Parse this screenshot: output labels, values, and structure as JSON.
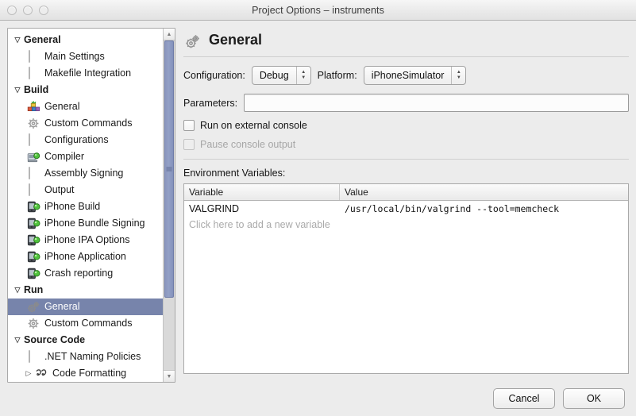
{
  "window": {
    "title": "Project Options – instruments",
    "traffic_lights": [
      "close",
      "minimize",
      "zoom"
    ]
  },
  "sidebar": {
    "items": [
      {
        "label": "General",
        "level": "group",
        "icon": "none",
        "twisty": "down",
        "selected": false
      },
      {
        "label": "Main Settings",
        "level": "child",
        "icon": "page",
        "twisty": "none",
        "selected": false
      },
      {
        "label": "Makefile Integration",
        "level": "child",
        "icon": "page",
        "twisty": "none",
        "selected": false
      },
      {
        "label": "Build",
        "level": "group",
        "icon": "none",
        "twisty": "down",
        "selected": false
      },
      {
        "label": "General",
        "level": "child",
        "icon": "blocks",
        "twisty": "none",
        "selected": false
      },
      {
        "label": "Custom Commands",
        "level": "child",
        "icon": "gear",
        "twisty": "none",
        "selected": false
      },
      {
        "label": "Configurations",
        "level": "child",
        "icon": "page",
        "twisty": "none",
        "selected": false
      },
      {
        "label": "Compiler",
        "level": "child",
        "icon": "compiler",
        "twisty": "none",
        "selected": false
      },
      {
        "label": "Assembly Signing",
        "level": "child",
        "icon": "page",
        "twisty": "none",
        "selected": false
      },
      {
        "label": "Output",
        "level": "child",
        "icon": "page",
        "twisty": "none",
        "selected": false
      },
      {
        "label": "iPhone Build",
        "level": "child",
        "icon": "phone",
        "twisty": "none",
        "selected": false
      },
      {
        "label": "iPhone Bundle Signing",
        "level": "child",
        "icon": "phone",
        "twisty": "none",
        "selected": false
      },
      {
        "label": "iPhone IPA Options",
        "level": "child",
        "icon": "phone",
        "twisty": "none",
        "selected": false
      },
      {
        "label": "iPhone Application",
        "level": "child",
        "icon": "phone",
        "twisty": "none",
        "selected": false
      },
      {
        "label": "Crash reporting",
        "level": "child",
        "icon": "phone",
        "twisty": "none",
        "selected": false
      },
      {
        "label": "Run",
        "level": "group",
        "icon": "none",
        "twisty": "down",
        "selected": false
      },
      {
        "label": "General",
        "level": "child",
        "icon": "gears",
        "twisty": "none",
        "selected": true
      },
      {
        "label": "Custom Commands",
        "level": "child",
        "icon": "gear",
        "twisty": "none",
        "selected": false
      },
      {
        "label": "Source Code",
        "level": "group",
        "icon": "none",
        "twisty": "down",
        "selected": false
      },
      {
        "label": ".NET Naming Policies",
        "level": "child",
        "icon": "page",
        "twisty": "none",
        "selected": false
      },
      {
        "label": "Code Formatting",
        "level": "child",
        "icon": "format",
        "twisty": "right",
        "selected": false
      }
    ],
    "scrollbar": {
      "up_arrow": "▲",
      "down_arrow": "▼"
    }
  },
  "panel": {
    "title": "General",
    "configuration": {
      "label": "Configuration:",
      "value": "Debug"
    },
    "platform": {
      "label": "Platform:",
      "value": "iPhoneSimulator"
    },
    "parameters": {
      "label": "Parameters:",
      "value": "",
      "placeholder": ""
    },
    "run_external_console": {
      "label": "Run on external console",
      "checked": false,
      "enabled": true
    },
    "pause_console_output": {
      "label": "Pause console output",
      "checked": false,
      "enabled": false
    },
    "env_section_label": "Environment Variables:",
    "env_table": {
      "columns": [
        "Variable",
        "Value"
      ],
      "rows": [
        {
          "variable": "VALGRIND",
          "value": "/usr/local/bin/valgrind --tool=memcheck"
        }
      ],
      "add_row_placeholder": "Click here to add a new variable"
    }
  },
  "footer": {
    "cancel_label": "Cancel",
    "ok_label": "OK"
  },
  "colors": {
    "selection": "#7784ab",
    "window_bg": "#ececec",
    "scrollbar_thumb": "#8f9cc4",
    "accent_green": "#3faa2e"
  }
}
